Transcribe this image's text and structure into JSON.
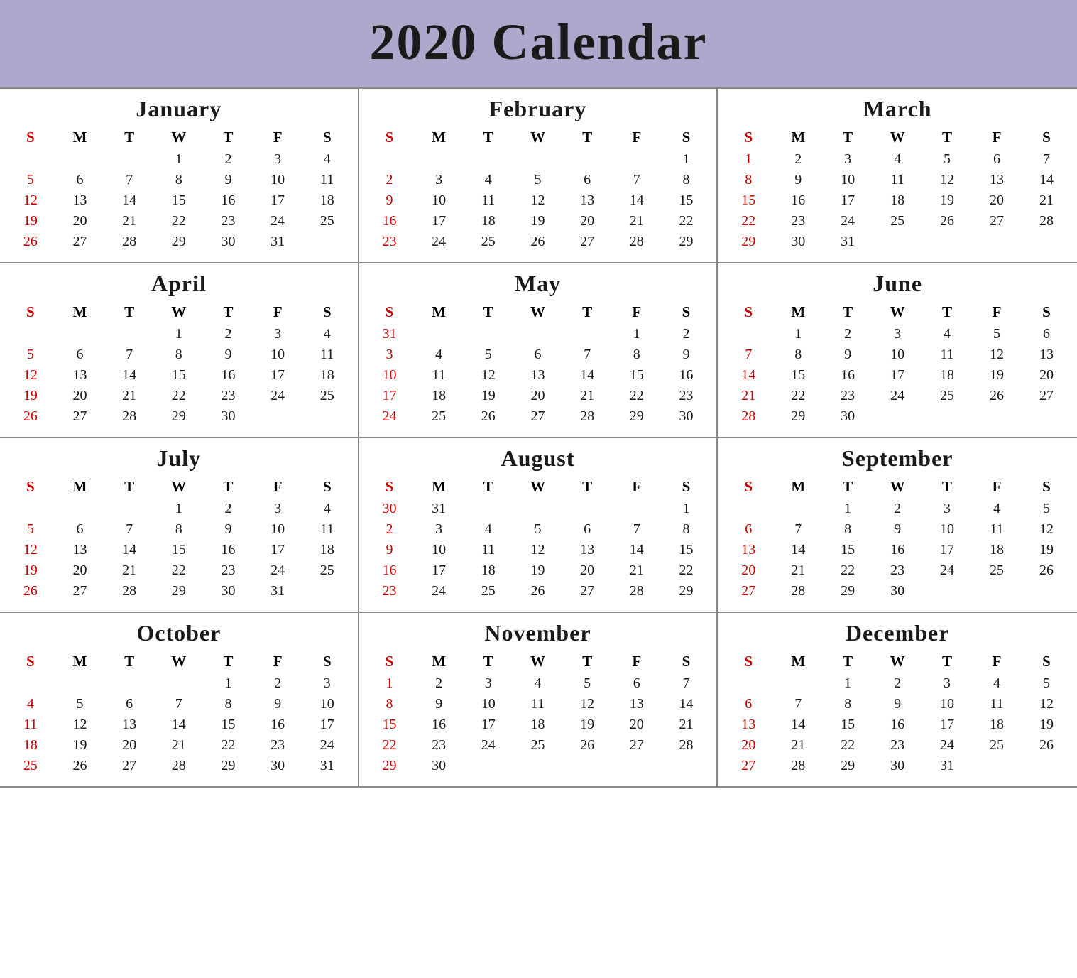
{
  "title": "2020 Calendar",
  "months": [
    {
      "name": "January",
      "weeks": [
        [
          "",
          "",
          "",
          "1",
          "2",
          "3",
          "4"
        ],
        [
          "5",
          "6",
          "7",
          "8",
          "9",
          "10",
          "11"
        ],
        [
          "12",
          "13",
          "14",
          "15",
          "16",
          "17",
          "18"
        ],
        [
          "19",
          "20",
          "21",
          "22",
          "23",
          "24",
          "25"
        ],
        [
          "26",
          "27",
          "28",
          "29",
          "30",
          "31",
          ""
        ]
      ]
    },
    {
      "name": "February",
      "weeks": [
        [
          "",
          "",
          "",
          "",
          "",
          "",
          "1"
        ],
        [
          "2",
          "3",
          "4",
          "5",
          "6",
          "7",
          "8"
        ],
        [
          "9",
          "10",
          "11",
          "12",
          "13",
          "14",
          "15"
        ],
        [
          "16",
          "17",
          "18",
          "19",
          "20",
          "21",
          "22"
        ],
        [
          "23",
          "24",
          "25",
          "26",
          "27",
          "28",
          "29"
        ]
      ]
    },
    {
      "name": "March",
      "weeks": [
        [
          "1",
          "2",
          "3",
          "4",
          "5",
          "6",
          "7"
        ],
        [
          "8",
          "9",
          "10",
          "11",
          "12",
          "13",
          "14"
        ],
        [
          "15",
          "16",
          "17",
          "18",
          "19",
          "20",
          "21"
        ],
        [
          "22",
          "23",
          "24",
          "25",
          "26",
          "27",
          "28"
        ],
        [
          "29",
          "30",
          "31",
          "",
          "",
          "",
          ""
        ]
      ]
    },
    {
      "name": "April",
      "weeks": [
        [
          "",
          "",
          "",
          "1",
          "2",
          "3",
          "4"
        ],
        [
          "5",
          "6",
          "7",
          "8",
          "9",
          "10",
          "11"
        ],
        [
          "12",
          "13",
          "14",
          "15",
          "16",
          "17",
          "18"
        ],
        [
          "19",
          "20",
          "21",
          "22",
          "23",
          "24",
          "25"
        ],
        [
          "26",
          "27",
          "28",
          "29",
          "30",
          "",
          ""
        ]
      ]
    },
    {
      "name": "May",
      "weeks": [
        [
          "31",
          "",
          "",
          "",
          "",
          "1",
          "2"
        ],
        [
          "3",
          "4",
          "5",
          "6",
          "7",
          "8",
          "9"
        ],
        [
          "10",
          "11",
          "12",
          "13",
          "14",
          "15",
          "16"
        ],
        [
          "17",
          "18",
          "19",
          "20",
          "21",
          "22",
          "23"
        ],
        [
          "24",
          "25",
          "26",
          "27",
          "28",
          "29",
          "30"
        ]
      ]
    },
    {
      "name": "June",
      "weeks": [
        [
          "",
          "1",
          "2",
          "3",
          "4",
          "5",
          "6"
        ],
        [
          "7",
          "8",
          "9",
          "10",
          "11",
          "12",
          "13"
        ],
        [
          "14",
          "15",
          "16",
          "17",
          "18",
          "19",
          "20"
        ],
        [
          "21",
          "22",
          "23",
          "24",
          "25",
          "26",
          "27"
        ],
        [
          "28",
          "29",
          "30",
          "",
          "",
          "",
          ""
        ]
      ]
    },
    {
      "name": "July",
      "weeks": [
        [
          "",
          "",
          "",
          "1",
          "2",
          "3",
          "4"
        ],
        [
          "5",
          "6",
          "7",
          "8",
          "9",
          "10",
          "11"
        ],
        [
          "12",
          "13",
          "14",
          "15",
          "16",
          "17",
          "18"
        ],
        [
          "19",
          "20",
          "21",
          "22",
          "23",
          "24",
          "25"
        ],
        [
          "26",
          "27",
          "28",
          "29",
          "30",
          "31",
          ""
        ]
      ]
    },
    {
      "name": "August",
      "weeks": [
        [
          "30",
          "31",
          "",
          "",
          "",
          "",
          "1"
        ],
        [
          "2",
          "3",
          "4",
          "5",
          "6",
          "7",
          "8"
        ],
        [
          "9",
          "10",
          "11",
          "12",
          "13",
          "14",
          "15"
        ],
        [
          "16",
          "17",
          "18",
          "19",
          "20",
          "21",
          "22"
        ],
        [
          "23",
          "24",
          "25",
          "26",
          "27",
          "28",
          "29"
        ]
      ]
    },
    {
      "name": "September",
      "weeks": [
        [
          "",
          "",
          "1",
          "2",
          "3",
          "4",
          "5"
        ],
        [
          "6",
          "7",
          "8",
          "9",
          "10",
          "11",
          "12"
        ],
        [
          "13",
          "14",
          "15",
          "16",
          "17",
          "18",
          "19"
        ],
        [
          "20",
          "21",
          "22",
          "23",
          "24",
          "25",
          "26"
        ],
        [
          "27",
          "28",
          "29",
          "30",
          "",
          "",
          ""
        ]
      ]
    },
    {
      "name": "October",
      "weeks": [
        [
          "",
          "",
          "",
          "",
          "1",
          "2",
          "3"
        ],
        [
          "4",
          "5",
          "6",
          "7",
          "8",
          "9",
          "10"
        ],
        [
          "11",
          "12",
          "13",
          "14",
          "15",
          "16",
          "17"
        ],
        [
          "18",
          "19",
          "20",
          "21",
          "22",
          "23",
          "24"
        ],
        [
          "25",
          "26",
          "27",
          "28",
          "29",
          "30",
          "31"
        ]
      ]
    },
    {
      "name": "November",
      "weeks": [
        [
          "1",
          "2",
          "3",
          "4",
          "5",
          "6",
          "7"
        ],
        [
          "8",
          "9",
          "10",
          "11",
          "12",
          "13",
          "14"
        ],
        [
          "15",
          "16",
          "17",
          "18",
          "19",
          "20",
          "21"
        ],
        [
          "22",
          "23",
          "24",
          "25",
          "26",
          "27",
          "28"
        ],
        [
          "29",
          "30",
          "",
          "",
          "",
          "",
          ""
        ]
      ]
    },
    {
      "name": "December",
      "weeks": [
        [
          "",
          "",
          "1",
          "2",
          "3",
          "4",
          "5"
        ],
        [
          "6",
          "7",
          "8",
          "9",
          "10",
          "11",
          "12"
        ],
        [
          "13",
          "14",
          "15",
          "16",
          "17",
          "18",
          "19"
        ],
        [
          "20",
          "21",
          "22",
          "23",
          "24",
          "25",
          "26"
        ],
        [
          "27",
          "28",
          "29",
          "30",
          "31",
          "",
          ""
        ]
      ]
    }
  ],
  "dayHeaders": [
    "S",
    "M",
    "T",
    "W",
    "T",
    "F",
    "S"
  ]
}
